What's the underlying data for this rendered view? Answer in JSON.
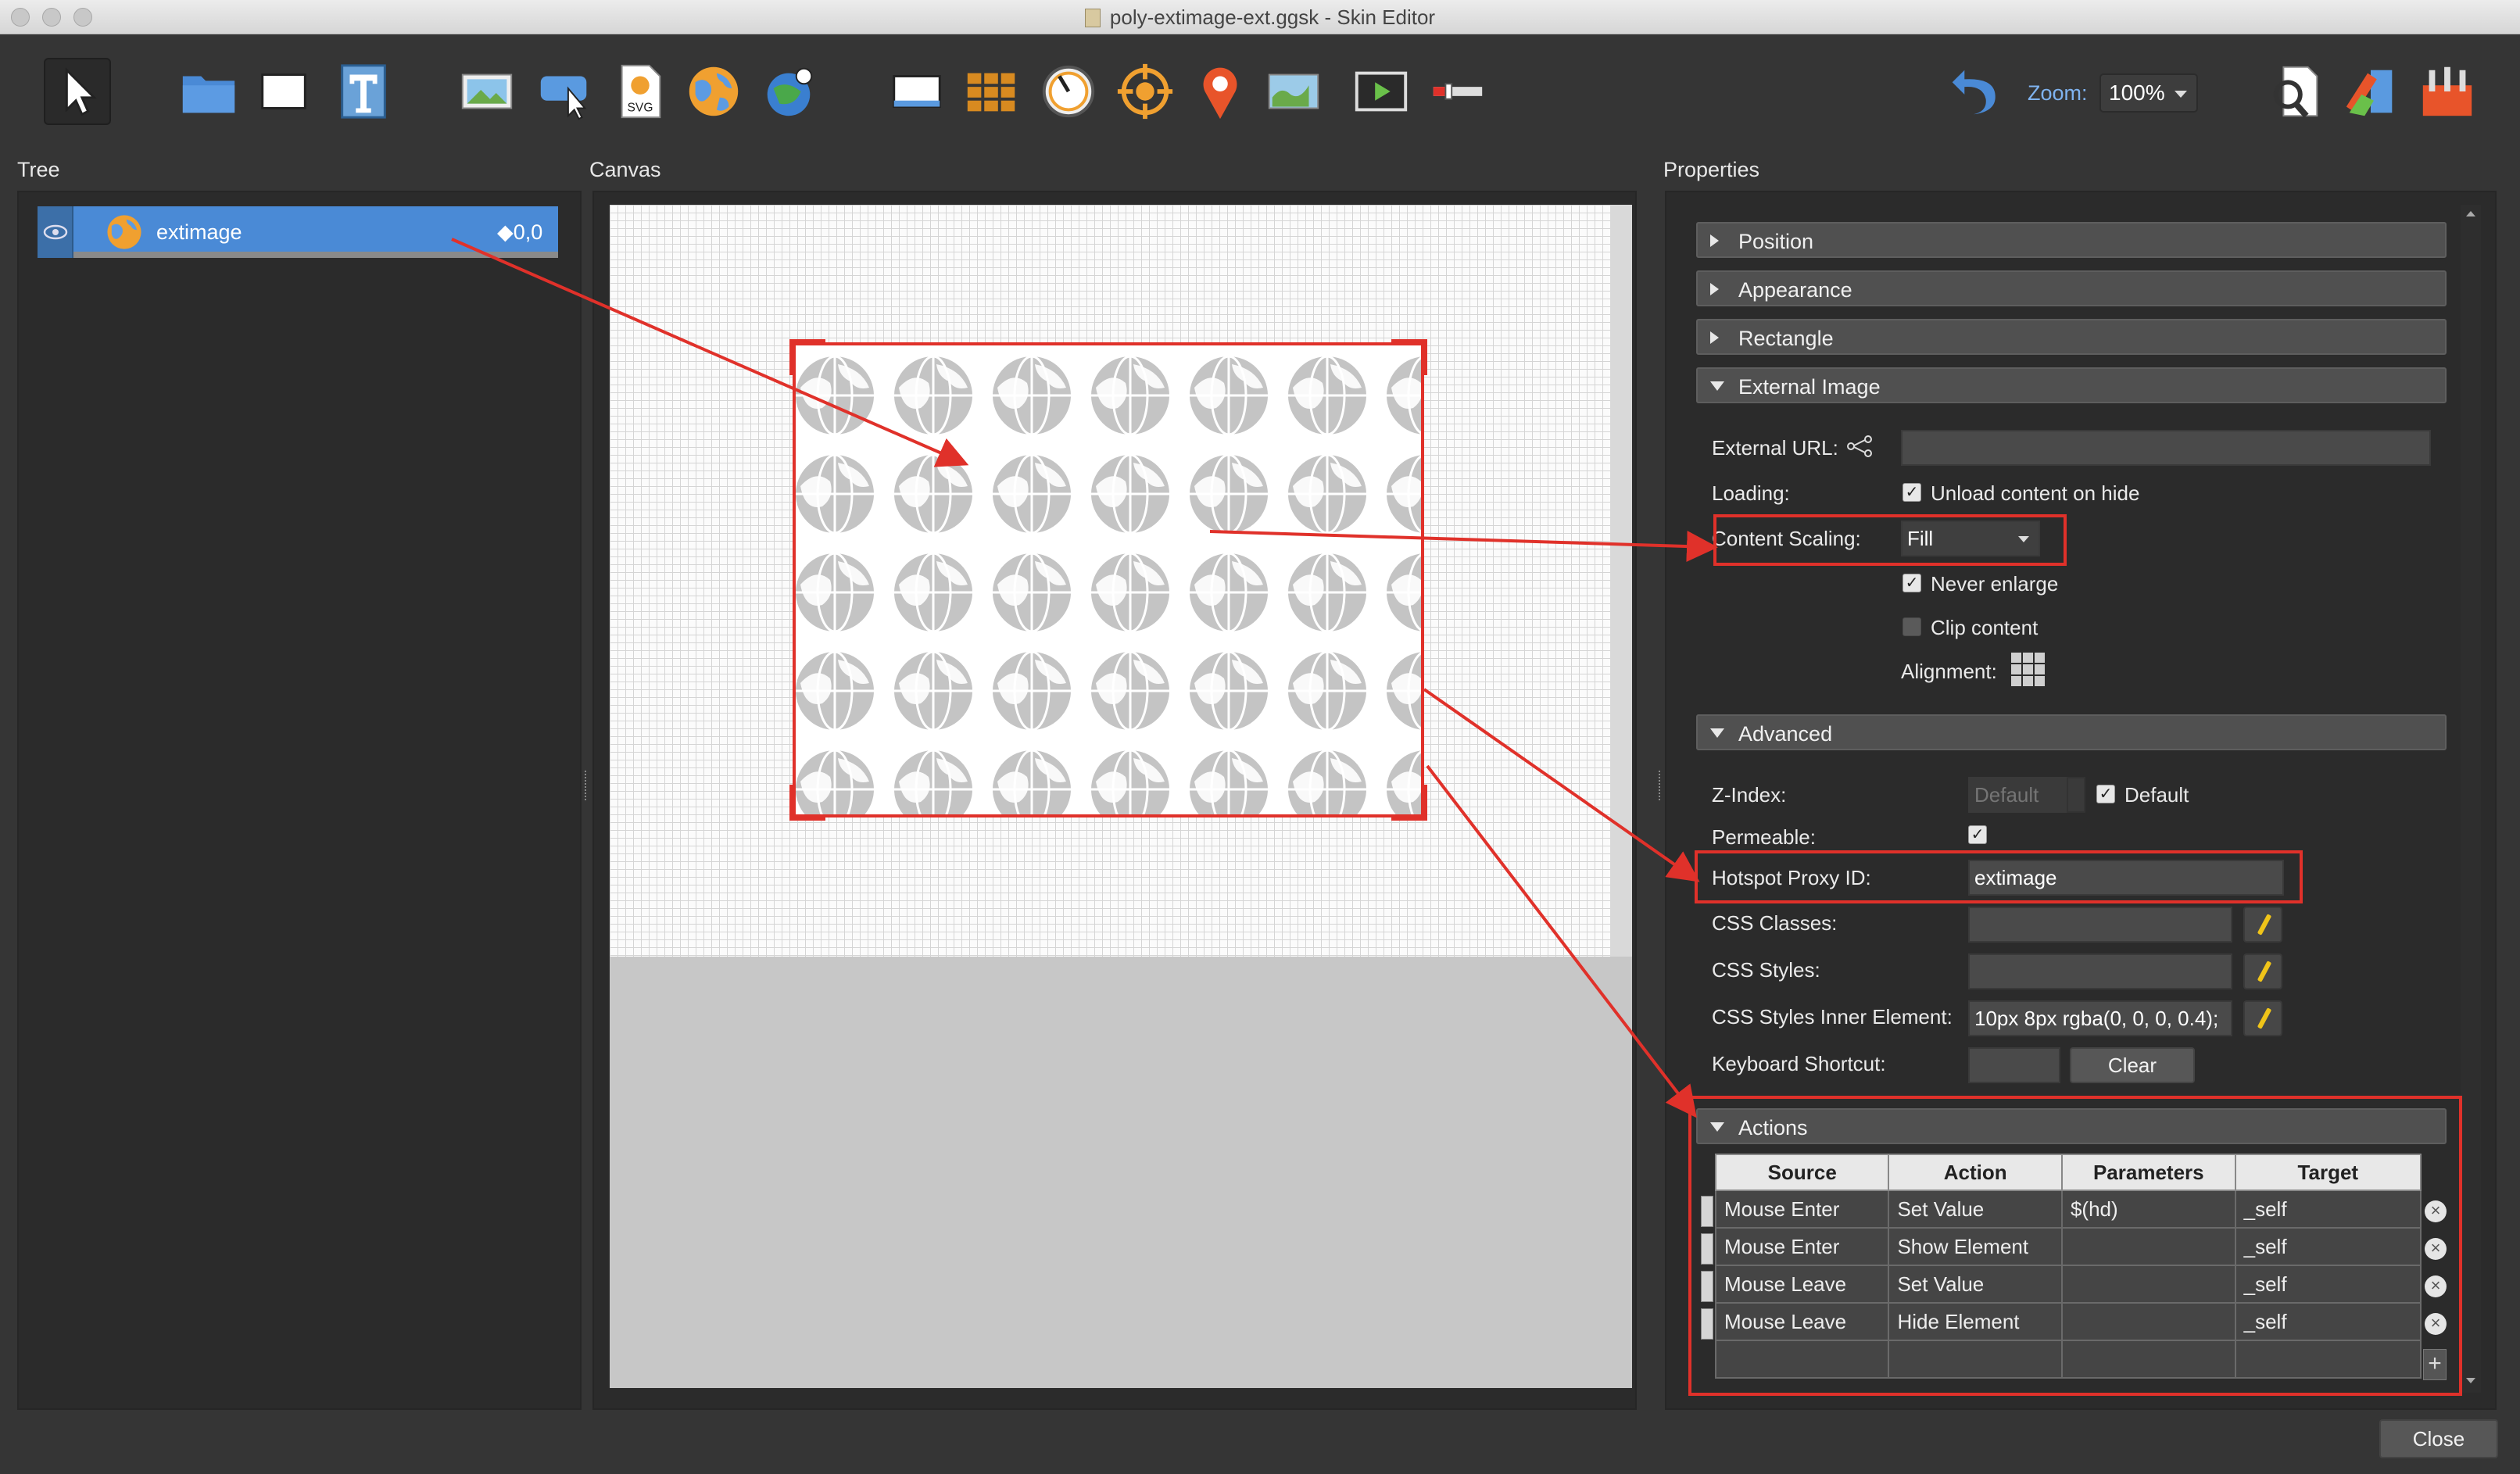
{
  "window": {
    "title": "poly-extimage-ext.ggsk - Skin Editor"
  },
  "toolbar": {
    "tools": [
      "select-arrow-icon",
      "folder-icon",
      "rectangle-icon",
      "text-icon",
      "image-icon",
      "hotspot-icon",
      "svg-icon",
      "external-image-icon",
      "cloner-icon",
      "container-icon",
      "grid-icon",
      "dial-icon",
      "target-icon",
      "map-pin-icon",
      "map-icon",
      "video-icon",
      "progress-bar-icon"
    ],
    "svg_label": "SVG",
    "zoom_label": "Zoom:",
    "zoom_value": "100%"
  },
  "panels": {
    "tree": "Tree",
    "canvas": "Canvas",
    "properties": "Properties"
  },
  "tree": {
    "item_label": "extimage",
    "item_value": "◆0,0"
  },
  "properties": {
    "sections": {
      "position": "Position",
      "appearance": "Appearance",
      "rectangle": "Rectangle",
      "external_image": "External Image",
      "advanced": "Advanced",
      "actions": "Actions"
    },
    "external_url_label": "External URL:",
    "external_url_value": "",
    "loading_label": "Loading:",
    "unload_label": "Unload content on hide",
    "unload_checked": true,
    "content_scaling_label": "Content Scaling:",
    "content_scaling_value": "Fill",
    "never_enlarge_label": "Never enlarge",
    "never_enlarge_checked": true,
    "clip_content_label": "Clip content",
    "clip_content_checked": false,
    "alignment_label": "Alignment:",
    "zindex_label": "Z-Index:",
    "zindex_placeholder": "Default",
    "zindex_default_label": "Default",
    "zindex_default_checked": true,
    "permeable_label": "Permeable:",
    "permeable_checked": true,
    "hotspot_proxy_label": "Hotspot Proxy ID:",
    "hotspot_proxy_value": "extimage",
    "css_classes_label": "CSS Classes:",
    "css_classes_value": "",
    "css_styles_label": "CSS Styles:",
    "css_styles_value": "",
    "css_inner_label": "CSS Styles Inner Element:",
    "css_inner_value": "10px 8px rgba(0, 0, 0, 0.4);",
    "keyboard_label": "Keyboard Shortcut:",
    "keyboard_value": "",
    "clear_label": "Clear"
  },
  "actions": {
    "columns": [
      "Source",
      "Action",
      "Parameters",
      "Target"
    ],
    "rows": [
      [
        "Mouse Enter",
        "Set Value",
        "$(hd)",
        "_self"
      ],
      [
        "Mouse Enter",
        "Show Element",
        "",
        "_self"
      ],
      [
        "Mouse Leave",
        "Set Value",
        "",
        "_self"
      ],
      [
        "Mouse Leave",
        "Hide Element",
        "",
        "_self"
      ]
    ]
  },
  "footer": {
    "close_label": "Close"
  },
  "colors": {
    "accent": "#4a8ad6",
    "annotation": "#e0312a",
    "zoom_label": "#7fb3f0"
  }
}
